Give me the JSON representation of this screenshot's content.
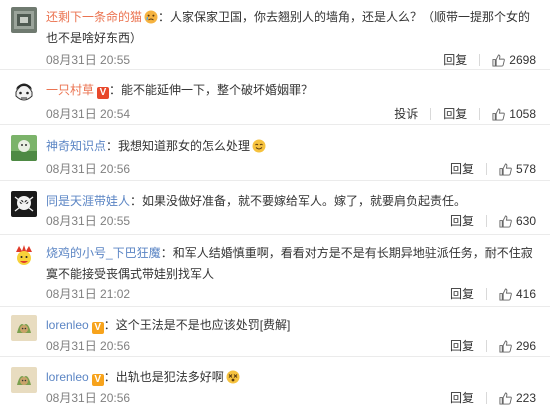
{
  "comments": [
    {
      "user": "还剩下一条命的猫",
      "separator": "：",
      "text": "人家保家卫国，你去翘别人的墙角，还是人么？（顺带一提那个女的也不是啥好东西）",
      "time": "08月31日 20:55",
      "reply": "回复",
      "likes": "2698"
    },
    {
      "user": "一只村草",
      "separator": "：",
      "text": "能不能延伸一下，整个破坏婚姻罪？",
      "time": "08月31日 20:54",
      "report": "投诉",
      "reply": "回复",
      "likes": "1058"
    },
    {
      "user": "神奇知识点",
      "separator": "：",
      "text": "我想知道那女的怎么处理",
      "time": "08月31日 20:56",
      "reply": "回复",
      "likes": "578"
    },
    {
      "user": "同是天涯带娃人",
      "separator": "：",
      "text": "如果没做好准备，就不要嫁给军人。嫁了，就要肩负起责任。",
      "time": "08月31日 20:55",
      "reply": "回复",
      "likes": "630"
    },
    {
      "user": "烧鸡的小号_下巴狂魔",
      "separator": "：",
      "text": "和军人结婚慎重啊，看看对方是不是有长期异地驻派任务，耐不住寂寞不能接受丧偶式带娃别找军人",
      "time": "08月31日 21:02",
      "reply": "回复",
      "likes": "416"
    },
    {
      "user": "lorenleo",
      "separator": "：",
      "text": "这个王法是不是也应该处罚[费解]",
      "time": "08月31日 20:56",
      "reply": "回复",
      "likes": "296"
    },
    {
      "user": "lorenleo",
      "separator": "：",
      "text": "出轨也是犯法多好啊",
      "time": "08月31日 20:56",
      "reply": "回复",
      "likes": "223"
    }
  ],
  "badges": {
    "v": "V"
  },
  "icons": {
    "like": "thumbs-up-icon",
    "emoji_cry": "crying-face-icon",
    "emoji_smile": "smiling-face-icon",
    "emoji_dizzy": "dizzy-face-icon"
  },
  "colors": {
    "username": "#eb7350",
    "username_alt": "#5b85c4",
    "badge_orange": "#f7a31c",
    "badge_red": "#e8482b",
    "time": "#808080",
    "divider": "#ebebeb"
  }
}
